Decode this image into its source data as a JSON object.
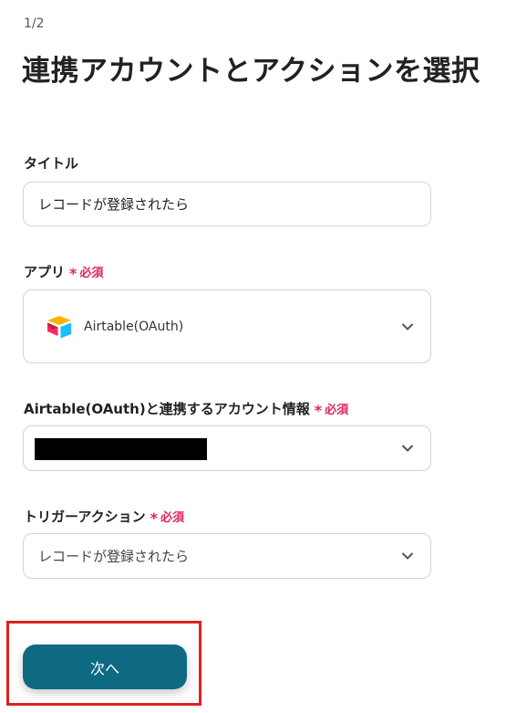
{
  "header": {
    "step": "1/2",
    "title": "連携アカウントとアクションを選択"
  },
  "form": {
    "title_field": {
      "label": "タイトル",
      "value": "レコードが登録されたら"
    },
    "app_field": {
      "label": "アプリ",
      "required_text": "必須",
      "value": "Airtable(OAuth)",
      "icon": "airtable-logo"
    },
    "account_field": {
      "label": "Airtable(OAuth)と連携するアカウント情報",
      "required_text": "必須",
      "value_redacted": true
    },
    "trigger_field": {
      "label": "トリガーアクション",
      "required_text": "必須",
      "value": "レコードが登録されたら"
    }
  },
  "footer": {
    "next_label": "次へ",
    "button_color": "#0e6a83",
    "highlight_color": "#e02020"
  },
  "colors": {
    "required": "#e0245e"
  }
}
